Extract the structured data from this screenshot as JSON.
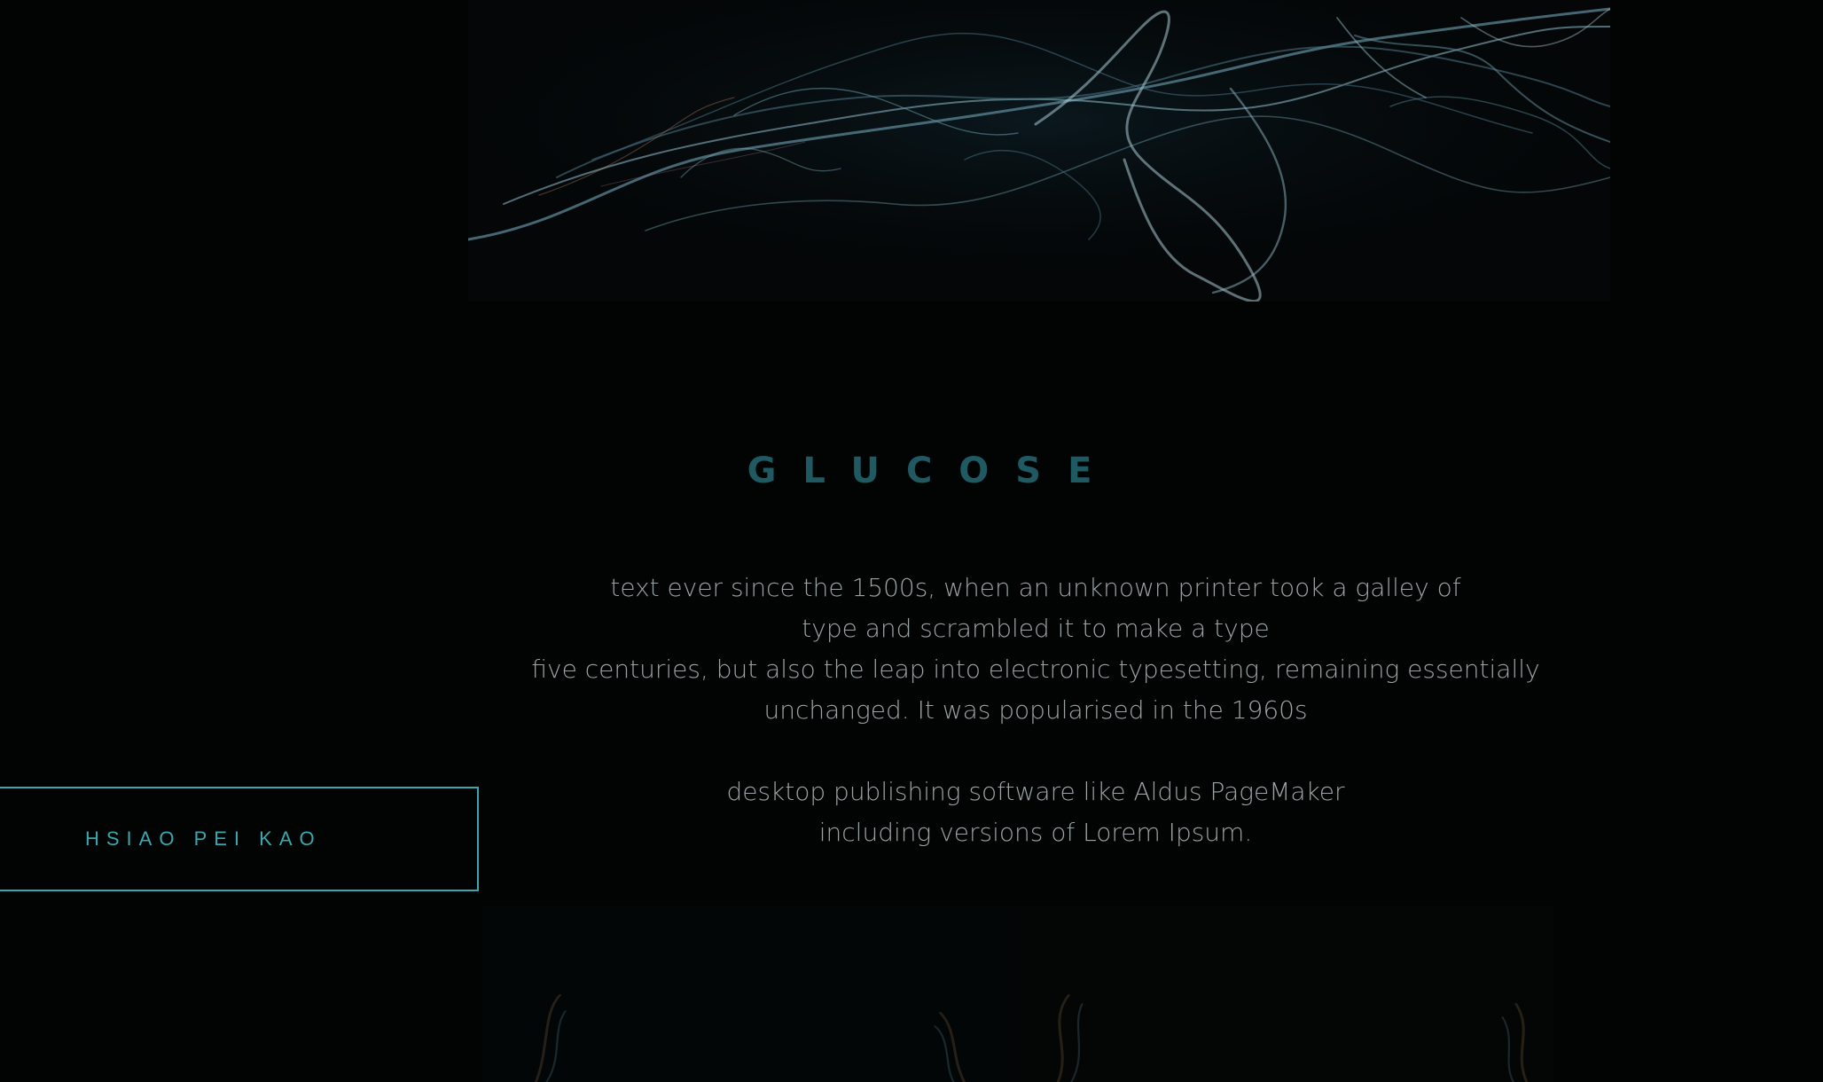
{
  "hero": {
    "image_icon": "abstract-fiber-image"
  },
  "project": {
    "title": "GLUCOSE",
    "paragraphs": [
      [
        "text ever since the 1500s, when an unknown printer took a galley of",
        "type and scrambled it to make a type",
        "five centuries, but also the leap into electronic typesetting, remaining essentially",
        "unchanged. It was popularised in the 1960s"
      ],
      [
        "desktop publishing software like Aldus PageMaker",
        "including versions of Lorem Ipsum."
      ]
    ]
  },
  "author": {
    "name": "HSIAO PEI KAO"
  },
  "colors": {
    "background": "#020303",
    "title": "#1f5961",
    "body_text": "#9aa3a6",
    "accent": "#3aa7ae"
  }
}
